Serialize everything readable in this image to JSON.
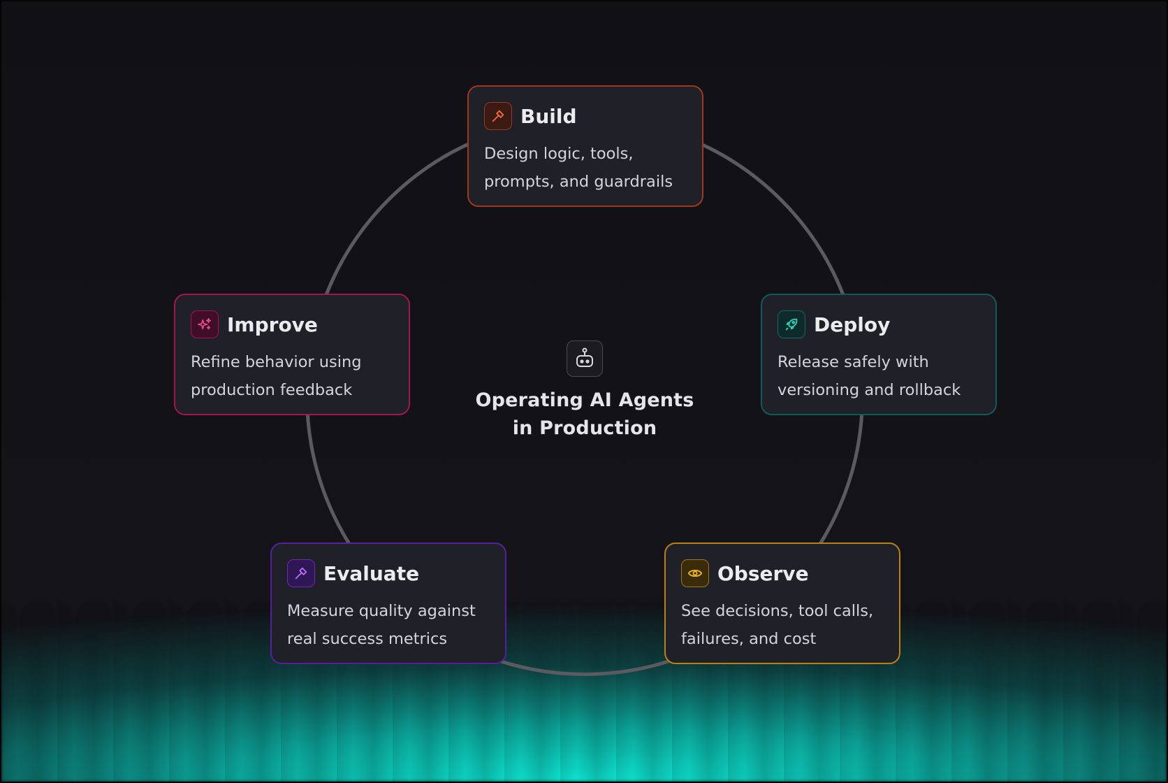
{
  "diagram": {
    "center": {
      "title": "Operating AI Agents\nin Production",
      "icon": "robot-icon"
    },
    "stages": [
      {
        "id": "build",
        "title": "Build",
        "description": "Design logic, tools,\nprompts, and guardrails",
        "icon": "hammer-icon",
        "accent": "#f26b3a"
      },
      {
        "id": "deploy",
        "title": "Deploy",
        "description": "Release safely with\nversioning and rollback",
        "icon": "rocket-icon",
        "accent": "#2dd4bf"
      },
      {
        "id": "observe",
        "title": "Observe",
        "description": "See decisions, tool calls,\nfailures, and cost",
        "icon": "eye-icon",
        "accent": "#f5b423"
      },
      {
        "id": "evaluate",
        "title": "Evaluate",
        "description": "Measure quality against\nreal success metrics",
        "icon": "hammer-icon",
        "accent": "#b06cf5"
      },
      {
        "id": "improve",
        "title": "Improve",
        "description": "Refine behavior using\nproduction feedback",
        "icon": "sparkles-icon",
        "accent": "#f0478e"
      }
    ]
  }
}
